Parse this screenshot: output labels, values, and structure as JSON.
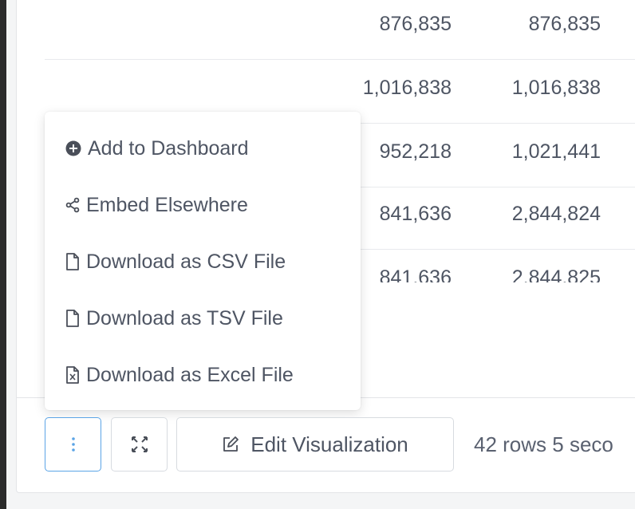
{
  "table": {
    "rows": [
      {
        "col1": "876,835",
        "col2": "876,835"
      },
      {
        "col1": "1,016,838",
        "col2": "1,016,838"
      },
      {
        "col1": "952,218",
        "col2": "1,021,441"
      },
      {
        "col1": "841,636",
        "col2": "2,844,824"
      },
      {
        "col1": "841,636",
        "col2": "2,844,825"
      }
    ]
  },
  "menu": {
    "items": [
      {
        "label": "Add to Dashboard",
        "icon": "plus-circle-icon"
      },
      {
        "label": "Embed Elsewhere",
        "icon": "share-icon"
      },
      {
        "label": "Download as CSV File",
        "icon": "file-icon"
      },
      {
        "label": "Download as TSV File",
        "icon": "file-icon"
      },
      {
        "label": "Download as Excel File",
        "icon": "excel-file-icon"
      }
    ]
  },
  "footer": {
    "more_icon": "kebab-menu-icon",
    "expand_icon": "fullscreen-icon",
    "edit_label": "Edit Visualization",
    "edit_icon": "edit-icon",
    "status": "42 rows 5 seco",
    "accent_color": "#5ba4e6"
  }
}
